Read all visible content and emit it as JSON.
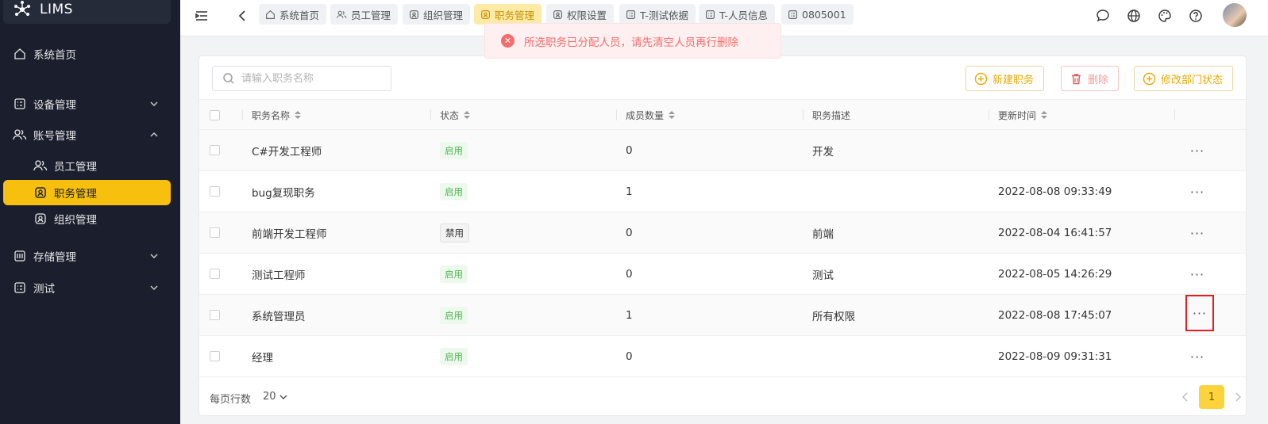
{
  "app": {
    "name": "LIMS"
  },
  "sidebar": {
    "items": [
      {
        "label": "系统首页",
        "icon": "home-icon"
      },
      {
        "label": "设备管理",
        "icon": "grid-icon",
        "expanded": false
      },
      {
        "label": "账号管理",
        "icon": "users-icon",
        "expanded": true
      },
      {
        "label": "员工管理",
        "icon": "users-icon"
      },
      {
        "label": "职务管理",
        "icon": "id-badge-icon",
        "active": true
      },
      {
        "label": "组织管理",
        "icon": "id-badge-icon"
      },
      {
        "label": "存储管理",
        "icon": "storage-icon",
        "expanded": false
      },
      {
        "label": "测试",
        "icon": "grid-icon",
        "expanded": false
      }
    ]
  },
  "tabs": [
    {
      "label": "系统首页",
      "icon": "home-icon"
    },
    {
      "label": "员工管理",
      "icon": "users-icon"
    },
    {
      "label": "组织管理",
      "icon": "id-badge-icon"
    },
    {
      "label": "职务管理",
      "icon": "id-badge-icon",
      "active": true
    },
    {
      "label": "权限设置",
      "icon": "id-badge-icon"
    },
    {
      "label": "T-测试依据",
      "icon": "grid-icon"
    },
    {
      "label": "T-人员信息",
      "icon": "grid-icon"
    },
    {
      "label": "0805001",
      "icon": "grid-icon"
    }
  ],
  "toast": {
    "message": "所选职务已分配人员，请先清空人员再行删除",
    "type": "error"
  },
  "search": {
    "placeholder": "请输入职务名称",
    "value": ""
  },
  "toolbar": {
    "new_label": "新建职务",
    "delete_label": "删除",
    "modify_label": "修改部门状态"
  },
  "table": {
    "columns": [
      "职务名称",
      "状态",
      "成员数量",
      "职务描述",
      "更新时间"
    ],
    "rows": [
      {
        "name": "C#开发工程师",
        "status": "启用",
        "members": "0",
        "desc": "开发",
        "updated": ""
      },
      {
        "name": "bug复现职务",
        "status": "启用",
        "members": "1",
        "desc": "",
        "updated": "2022-08-08 09:33:49"
      },
      {
        "name": "前端开发工程师",
        "status": "禁用",
        "members": "0",
        "desc": "前端",
        "updated": "2022-08-04 16:41:57"
      },
      {
        "name": "测试工程师",
        "status": "启用",
        "members": "0",
        "desc": "测试",
        "updated": "2022-08-05 14:26:29"
      },
      {
        "name": "系统管理员",
        "status": "启用",
        "members": "1",
        "desc": "所有权限",
        "updated": "2022-08-08 17:45:07"
      },
      {
        "name": "经理",
        "status": "启用",
        "members": "0",
        "desc": "",
        "updated": "2022-08-09 09:31:31"
      }
    ],
    "more_label": "···"
  },
  "pagination": {
    "rows_per_page_label": "每页行数",
    "page_size": "20",
    "current_page": "1"
  },
  "colors": {
    "accent": "#f7c00f",
    "sidebar_bg": "#1b1f2d",
    "error": "#f56c6c",
    "enabled": "#52b552"
  }
}
